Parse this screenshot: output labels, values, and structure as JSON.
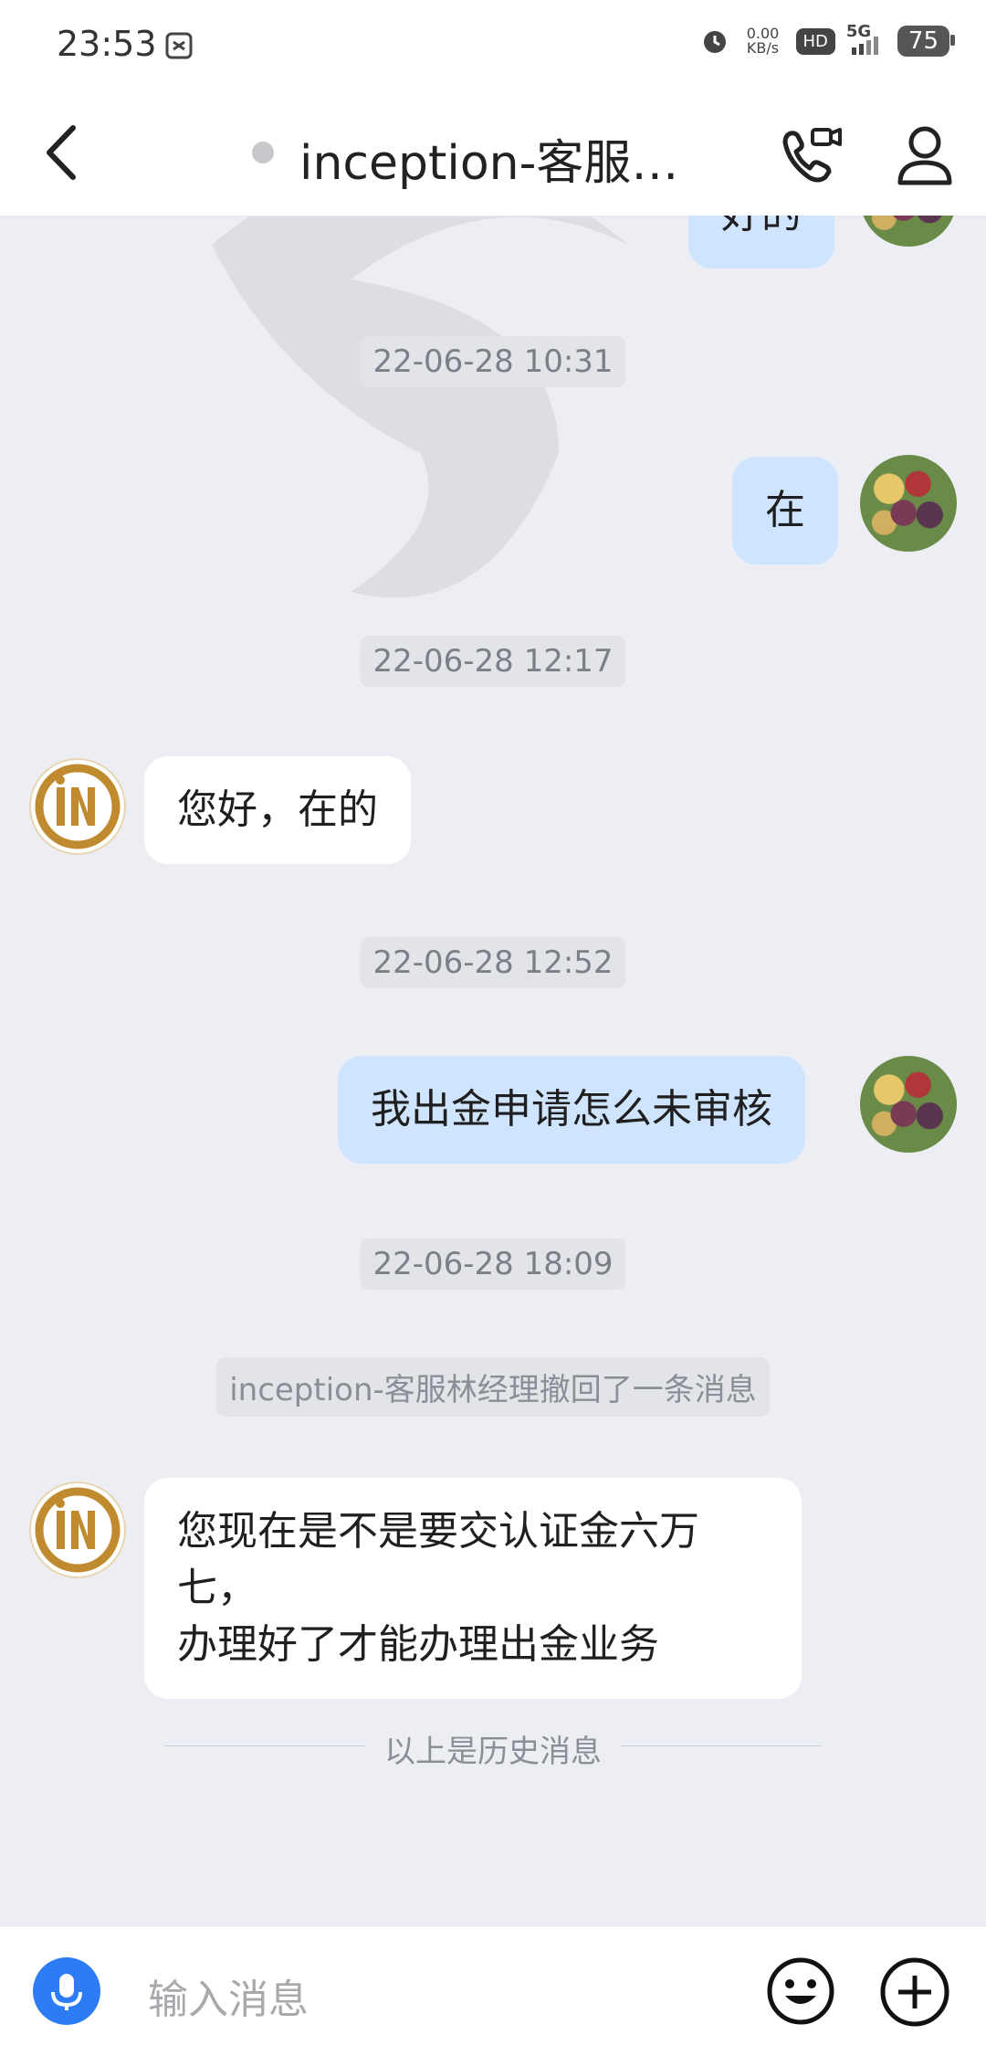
{
  "status_bar": {
    "time": "23:53",
    "net_speed_value": "0.00",
    "net_speed_unit": "KB/s",
    "hd_label": "HD",
    "network": "5G",
    "battery": "75"
  },
  "header": {
    "title": "inception-客服…",
    "icons": [
      "back-arrow-icon",
      "phone-video-icon",
      "profile-icon"
    ]
  },
  "messages": {
    "partial_top": "好的",
    "ts1": "22-06-28 10:31",
    "me1": "在",
    "ts2": "22-06-28 12:17",
    "other1": "您好，在的",
    "ts3": "22-06-28 12:52",
    "me2": "我出金申请怎么未审核",
    "ts4": "22-06-28 18:09",
    "system_recall": "inception-客服林经理撤回了一条消息",
    "other2_line1": "您现在是不是要交认证金六万七，",
    "other2_line2": "办理好了才能办理出金业务",
    "history_divider": "以上是历史消息"
  },
  "input": {
    "placeholder": "输入消息",
    "icons": [
      "microphone-icon",
      "emoji-icon",
      "plus-icon"
    ]
  },
  "colors": {
    "my_bubble": "#cfe5ff",
    "other_bubble": "#ffffff",
    "background": "#eceef3",
    "mic_button": "#2d7cf6",
    "logo_gold": "#c08a2e"
  }
}
